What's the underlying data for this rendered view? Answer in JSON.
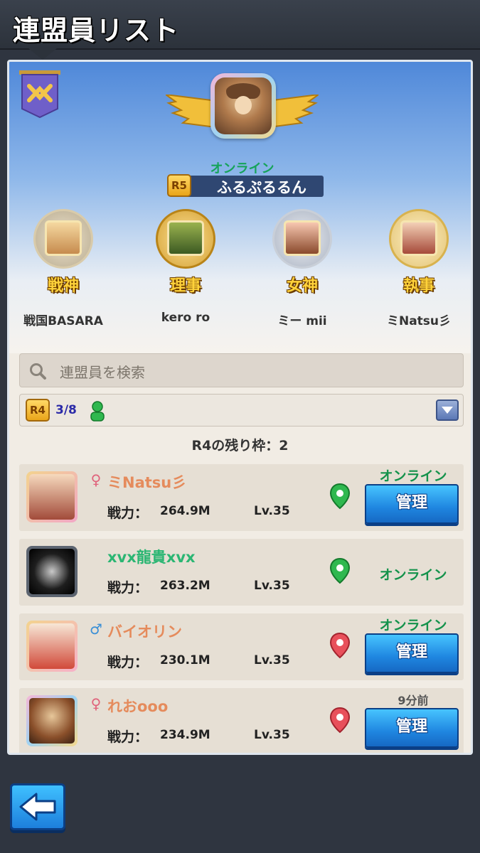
{
  "header": {
    "title": "連盟員リスト"
  },
  "leader": {
    "status": "オンライン",
    "rank": "R5",
    "name": "ふるぷるるん"
  },
  "officers": [
    {
      "role": "戦神",
      "name": "戦国BASARA"
    },
    {
      "role": "理事",
      "name": "kero ro"
    },
    {
      "role": "女神",
      "name": "ミー mii"
    },
    {
      "role": "執事",
      "name": "ミNatsu彡"
    }
  ],
  "search": {
    "placeholder": "連盟員を検索"
  },
  "filter": {
    "rank": "R4",
    "count": "3/8"
  },
  "slots_text": "R4の残り枠：2",
  "power_label": "戦力：",
  "manage_label": "管理",
  "members": [
    {
      "name": "ミNatsu彡",
      "gender": "female",
      "power": "264.9M",
      "level": "Lv.35",
      "status": "オンライン",
      "location": "green",
      "manage": true
    },
    {
      "name": "xvx龍貴xvx",
      "gender": "none",
      "power": "263.2M",
      "level": "Lv.35",
      "status": "オンライン",
      "location": "green",
      "manage": false
    },
    {
      "name": "バイオリン",
      "gender": "male",
      "power": "230.1M",
      "level": "Lv.35",
      "status": "オンライン",
      "location": "red",
      "manage": true
    },
    {
      "name": "れおooo",
      "gender": "female",
      "power": "234.9M",
      "level": "Lv.35",
      "status": "9分前",
      "location": "red",
      "manage": true
    }
  ],
  "colors": {
    "online": "#14924b",
    "button": "#1f86e0",
    "name": "#e58b5c",
    "name_green": "#2bb673"
  }
}
